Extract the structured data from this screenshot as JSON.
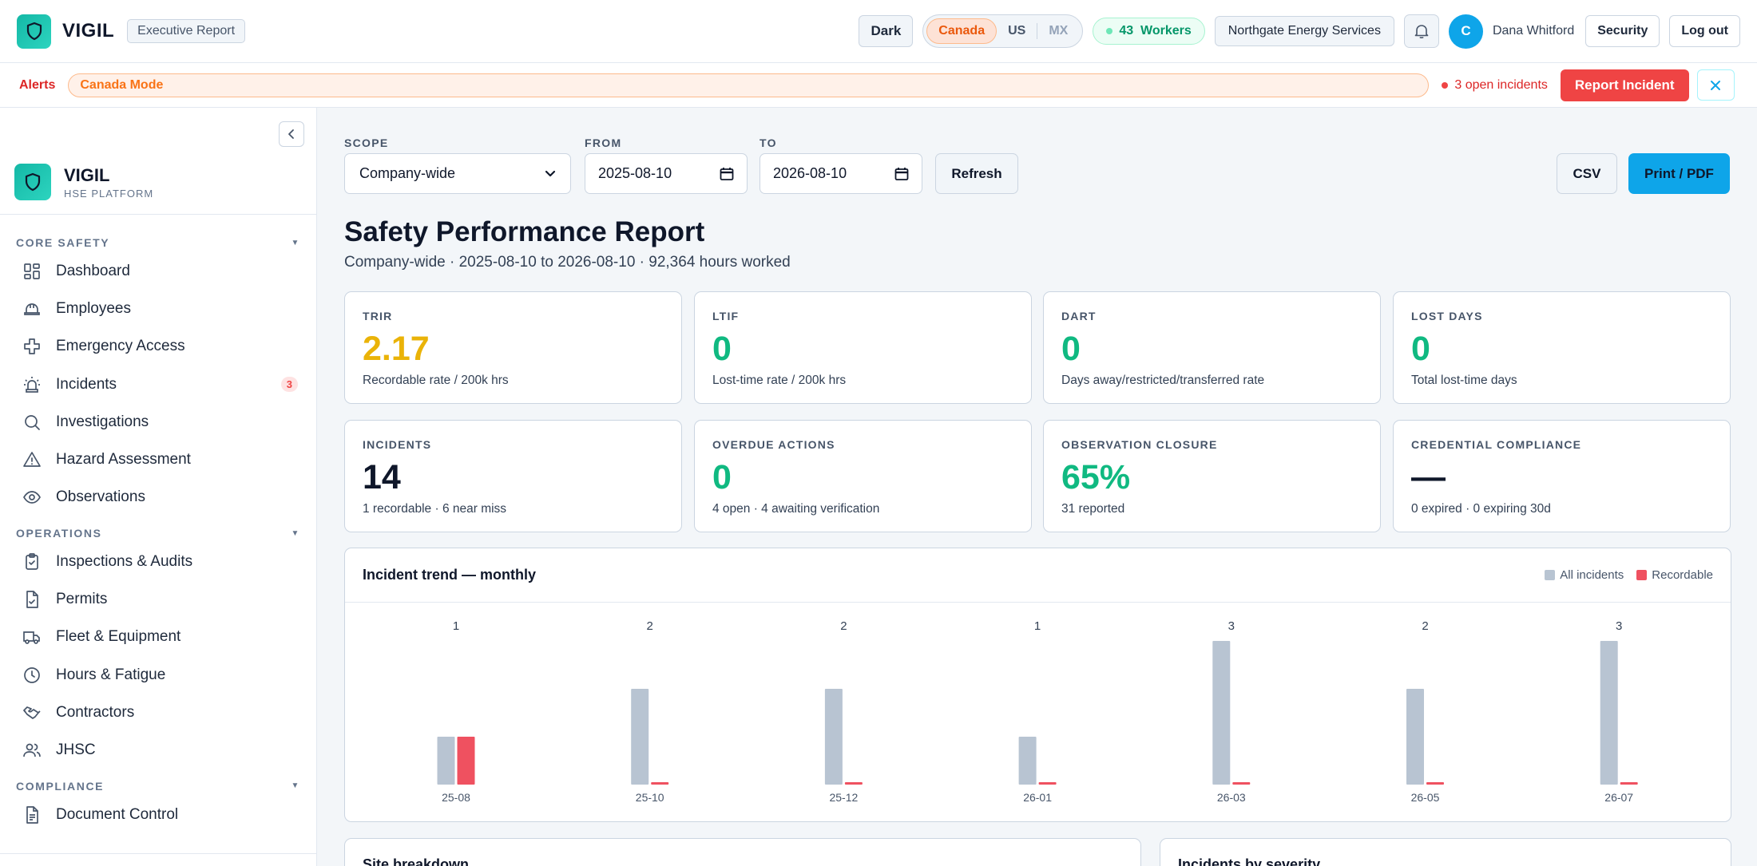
{
  "app": {
    "brand": "VIGIL",
    "report_tag": "Executive Report"
  },
  "topbar": {
    "theme_button": "Dark",
    "regions": [
      {
        "label": "Canada",
        "active": true
      },
      {
        "label": "US",
        "active": false
      },
      {
        "label": "MX",
        "active": false
      }
    ],
    "workers_label": "43  Workers",
    "company": "Northgate Energy Services",
    "user_initial": "C",
    "user_name": "Dana Whitford",
    "security_button": "Security",
    "logout_button": "Log out"
  },
  "alertbar": {
    "label": "Alerts",
    "mode": "Canada Mode",
    "open_incidents": "3 open incidents",
    "report_button": "Report Incident",
    "close_icon": "close-icon"
  },
  "sidebar": {
    "brand": "VIGIL",
    "brand_sub": "HSE PLATFORM",
    "sections": [
      {
        "title": "CORE SAFETY",
        "items": [
          {
            "label": "Dashboard",
            "icon": "dashboard-icon"
          },
          {
            "label": "Employees",
            "icon": "hardhat-icon"
          },
          {
            "label": "Emergency Access",
            "icon": "medical-cross-icon"
          },
          {
            "label": "Incidents",
            "icon": "siren-icon",
            "badge": "3"
          },
          {
            "label": "Investigations",
            "icon": "search-icon"
          },
          {
            "label": "Hazard Assessment",
            "icon": "warning-icon"
          },
          {
            "label": "Observations",
            "icon": "eye-icon"
          }
        ]
      },
      {
        "title": "OPERATIONS",
        "items": [
          {
            "label": "Inspections & Audits",
            "icon": "clipboard-check-icon"
          },
          {
            "label": "Permits",
            "icon": "file-check-icon"
          },
          {
            "label": "Fleet & Equipment",
            "icon": "truck-icon"
          },
          {
            "label": "Hours & Fatigue",
            "icon": "clock-icon"
          },
          {
            "label": "Contractors",
            "icon": "handshake-icon"
          },
          {
            "label": "JHSC",
            "icon": "users-icon"
          }
        ]
      },
      {
        "title": "COMPLIANCE",
        "items": [
          {
            "label": "Document Control",
            "icon": "document-icon"
          }
        ]
      }
    ]
  },
  "filters": {
    "scope_label": "SCOPE",
    "scope_value": "Company-wide",
    "from_label": "FROM",
    "from_value": "2025-08-10",
    "to_label": "TO",
    "to_value": "2026-08-10",
    "refresh": "Refresh",
    "csv": "CSV",
    "print": "Print / PDF"
  },
  "report": {
    "title": "Safety Performance Report",
    "subtitle": "Company-wide · 2025-08-10 to 2026-08-10 · 92,364 hours worked"
  },
  "kpis": [
    {
      "label": "TRIR",
      "value": "2.17",
      "desc": "Recordable rate / 200k hrs",
      "color": "#eab308"
    },
    {
      "label": "LTIF",
      "value": "0",
      "desc": "Lost-time rate / 200k hrs",
      "color": "#10b981"
    },
    {
      "label": "DART",
      "value": "0",
      "desc": "Days away/restricted/transferred rate",
      "color": "#10b981"
    },
    {
      "label": "LOST DAYS",
      "value": "0",
      "desc": "Total lost-time days",
      "color": "#10b981"
    },
    {
      "label": "INCIDENTS",
      "value": "14",
      "desc": "1 recordable · 6 near miss",
      "color": "#0f172a"
    },
    {
      "label": "OVERDUE ACTIONS",
      "value": "0",
      "desc": "4 open · 4 awaiting verification",
      "color": "#10b981"
    },
    {
      "label": "OBSERVATION CLOSURE",
      "value": "65%",
      "desc": "31 reported",
      "color": "#10b981"
    },
    {
      "label": "CREDENTIAL COMPLIANCE",
      "value": "—",
      "desc": "0 expired · 0 expiring 30d",
      "color": "#0f172a"
    }
  ],
  "chart_data": {
    "type": "bar",
    "title": "Incident trend — monthly",
    "categories": [
      "25-08",
      "25-10",
      "25-12",
      "26-01",
      "26-03",
      "26-05",
      "26-07"
    ],
    "series": [
      {
        "name": "All incidents",
        "values": [
          1,
          2,
          2,
          1,
          3,
          2,
          3
        ],
        "color": "#b8c4d2"
      },
      {
        "name": "Recordable",
        "values": [
          1,
          0,
          0,
          0,
          0,
          0,
          0
        ],
        "color": "#ef5160"
      }
    ],
    "ylim": [
      0,
      3
    ]
  },
  "bottom_cards": {
    "site_breakdown": "Site breakdown",
    "incidents_by_severity": "Incidents by severity"
  }
}
